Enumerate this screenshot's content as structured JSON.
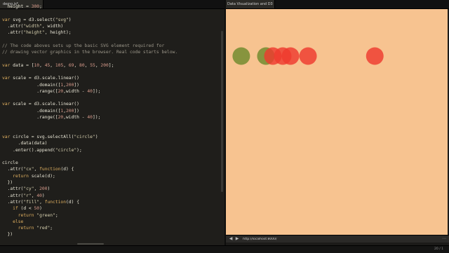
{
  "editor": {
    "tab_label": "demo.js*",
    "lines": [
      "  height = 300;",
      "",
      "var svg = d3.select(\"svg\")",
      "  .attr(\"width\", width)",
      "  .attr(\"height\", height);",
      "",
      "// The code aboves sets up the basic SVG element required for",
      "// drawing vector graphics in the browser. Real code starts below.",
      "",
      "var data = [10, 45, 105, 69, 80, 55, 200];",
      "",
      "var scale = d3.scale.linear()",
      "             .domain([1,200])",
      "             .range([20,width - 40]);",
      "",
      "var scale = d3.scale.linear()",
      "             .domain([1,200])",
      "             .range([20,width - 40]);",
      "",
      "",
      "var circle = svg.selectAll(\"circle\")",
      "      .data(data)",
      "    .enter().append(\"circle\");",
      "",
      "circle",
      "  .attr(\"cx\", function(d) {",
      "    return scale(d);",
      "  })",
      "  .attr(\"cy\", 200)",
      "  .attr(\"r\", 40)",
      "  .attr(\"fill\", function(d) {",
      "    if (d < 50)",
      "      return \"green\";",
      "    else",
      "      return \"red\";",
      "  })"
    ]
  },
  "preview": {
    "tab_label": "Data Visualization and D3",
    "url": "http://localhost:8000/",
    "back_icon": "back-arrow-icon",
    "forward_icon": "forward-arrow-icon",
    "colors": {
      "background": "#f7c390",
      "green": "#6e8a2c",
      "red": "#ee3b2e"
    },
    "circles": [
      {
        "value": 10,
        "fill": "green"
      },
      {
        "value": 45,
        "fill": "green"
      },
      {
        "value": 105,
        "fill": "red"
      },
      {
        "value": 69,
        "fill": "red"
      },
      {
        "value": 80,
        "fill": "red"
      },
      {
        "value": 55,
        "fill": "red"
      },
      {
        "value": 200,
        "fill": "red"
      }
    ]
  },
  "status_bar": {
    "text": "20 / 1"
  }
}
